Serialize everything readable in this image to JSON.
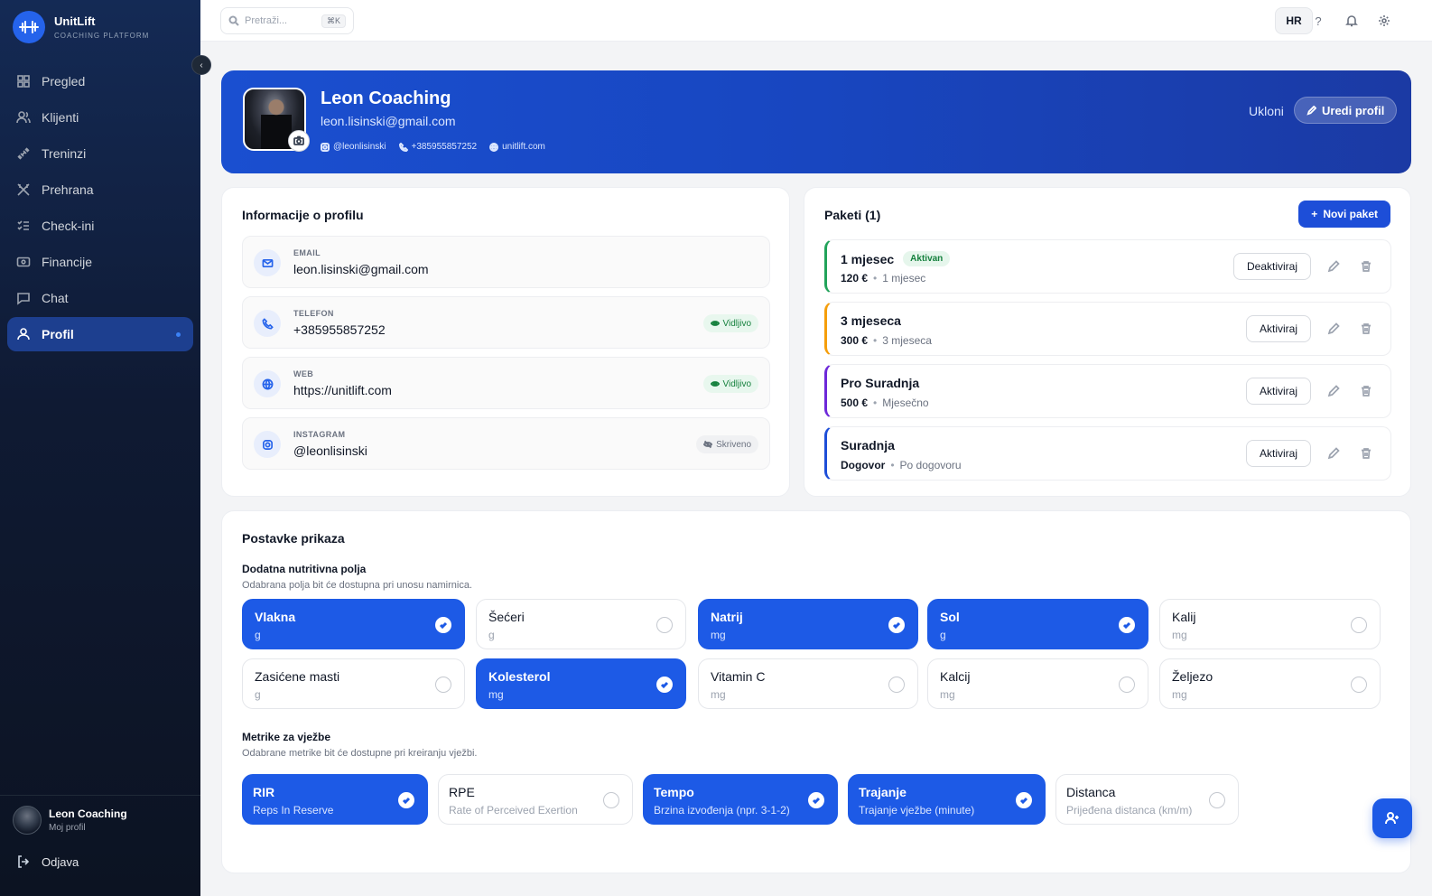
{
  "brand": {
    "name": "UnitLift",
    "subtitle": "COACHING PLATFORM"
  },
  "sidebar": {
    "items": [
      {
        "label": "Pregled",
        "icon": "grid-icon"
      },
      {
        "label": "Klijenti",
        "icon": "users-icon"
      },
      {
        "label": "Treninzi",
        "icon": "dumbbell-icon"
      },
      {
        "label": "Prehrana",
        "icon": "utensils-icon"
      },
      {
        "label": "Check-ini",
        "icon": "checklist-icon"
      },
      {
        "label": "Financije",
        "icon": "wallet-icon"
      },
      {
        "label": "Chat",
        "icon": "chat-icon"
      },
      {
        "label": "Profil",
        "icon": "user-icon",
        "active": true
      }
    ],
    "user": {
      "name": "Leon Coaching",
      "sub": "Moj profil"
    },
    "logout": "Odjava"
  },
  "topbar": {
    "search_placeholder": "Pretraži...",
    "shortcut": "⌘K",
    "language": "HR",
    "help": "?"
  },
  "hero": {
    "name": "Leon Coaching",
    "email": "leon.lisinski@gmail.com",
    "instagram": "@leonlisinski",
    "phone": "+385955857252",
    "website": "unitlift.com",
    "remove_label": "Ukloni",
    "edit_label": "Uredi profil"
  },
  "info": {
    "title": "Informacije o profilu",
    "rows": [
      {
        "label": "EMAIL",
        "value": "leon.lisinski@gmail.com",
        "badge": ""
      },
      {
        "label": "TELEFON",
        "value": "+385955857252",
        "badge": "Vidljivo"
      },
      {
        "label": "WEB",
        "value": "https://unitlift.com",
        "badge": "Vidljivo"
      },
      {
        "label": "INSTAGRAM",
        "value": "@leonlisinski",
        "badge": "Skriveno"
      }
    ]
  },
  "packages": {
    "title": "Paketi (1)",
    "new_label": "Novi paket",
    "items": [
      {
        "name": "1 mjesec",
        "badge": "Aktivan",
        "price": "120 €",
        "period": "1 mjesec",
        "action": "Deaktiviraj",
        "color": "#22a35a"
      },
      {
        "name": "3 mjeseca",
        "badge": "",
        "price": "300 €",
        "period": "3 mjeseca",
        "action": "Aktiviraj",
        "color": "#f59e0b"
      },
      {
        "name": "Pro Suradnja",
        "badge": "",
        "price": "500 €",
        "period": "Mjesečno",
        "action": "Aktiviraj",
        "color": "#6d28d9"
      },
      {
        "name": "Suradnja",
        "badge": "",
        "price": "Dogovor",
        "period": "Po dogovoru",
        "action": "Aktiviraj",
        "color": "#1d4ed8"
      }
    ]
  },
  "settings": {
    "title": "Postavke prikaza",
    "nutrition": {
      "title": "Dodatna nutritivna polja",
      "desc": "Odabrana polja bit će dostupna pri unosu namirnica.",
      "options": [
        {
          "name": "Vlakna",
          "unit": "g",
          "selected": true
        },
        {
          "name": "Šećeri",
          "unit": "g",
          "selected": false
        },
        {
          "name": "Natrij",
          "unit": "mg",
          "selected": true
        },
        {
          "name": "Sol",
          "unit": "g",
          "selected": true
        },
        {
          "name": "Kalij",
          "unit": "mg",
          "selected": false
        },
        {
          "name": "Zasićene masti",
          "unit": "g",
          "selected": false
        },
        {
          "name": "Kolesterol",
          "unit": "mg",
          "selected": true
        },
        {
          "name": "Vitamin C",
          "unit": "mg",
          "selected": false
        },
        {
          "name": "Kalcij",
          "unit": "mg",
          "selected": false
        },
        {
          "name": "Željezo",
          "unit": "mg",
          "selected": false
        }
      ]
    },
    "metrics": {
      "title": "Metrike za vježbe",
      "desc": "Odabrane metrike bit će dostupne pri kreiranju vježbi.",
      "options": [
        {
          "name": "RIR",
          "unit": "Reps In Reserve",
          "selected": true
        },
        {
          "name": "RPE",
          "unit": "Rate of Perceived Exertion",
          "selected": false
        },
        {
          "name": "Tempo",
          "unit": "Brzina izvođenja (npr. 3-1-2)",
          "selected": true
        },
        {
          "name": "Trajanje",
          "unit": "Trajanje vježbe (minute)",
          "selected": true
        },
        {
          "name": "Distanca",
          "unit": "Prijeđena distanca (km/m)",
          "selected": false
        }
      ]
    }
  },
  "colors": {
    "accent": "#1d5ae6",
    "hero_bg": "#1a4fd0",
    "sidebar_bg": "#0f1a33"
  }
}
